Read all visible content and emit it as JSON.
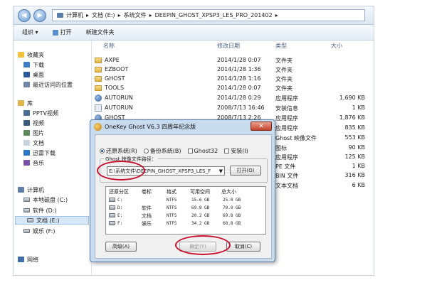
{
  "address_bar": {
    "crumbs": [
      "计算机",
      "▸",
      "文档 (E:)",
      "▸",
      "系统文件",
      "▸",
      "DEEPIN_GHOST_XPSP3_LES_PRO_201402",
      "▸"
    ],
    "back_glyph": "◀",
    "forward_glyph": "▶"
  },
  "toolbar": {
    "organize": "组织 ▾",
    "open": "打开",
    "new_folder": "新建文件夹"
  },
  "sidebar": {
    "favorites": "收藏夹",
    "fav_items": [
      "下载",
      "桌面",
      "最近访问的位置"
    ],
    "library": "库",
    "lib_items": [
      "PPTV视频",
      "视频",
      "图片",
      "文档",
      "迅雷下载",
      "音乐"
    ],
    "computer": "计算机",
    "drives": [
      "本地磁盘 (C:)",
      "软件 (D:)",
      "文档 (E:)",
      "娱乐 (F:)"
    ],
    "network": "网络"
  },
  "list": {
    "headers": {
      "name": "名称",
      "date": "修改日期",
      "type": "类型",
      "size": "大小"
    },
    "rows": [
      {
        "name": "AXPE",
        "date": "2014/1/28 0:07",
        "type": "文件夹",
        "size": "",
        "icon": "folder-icon"
      },
      {
        "name": "EZBOOT",
        "date": "2014/1/28 1:36",
        "type": "文件夹",
        "size": "",
        "icon": "folder-icon"
      },
      {
        "name": "GHOST",
        "date": "2014/1/28 1:16",
        "type": "文件夹",
        "size": "",
        "icon": "folder-icon"
      },
      {
        "name": "TOOLS",
        "date": "2014/1/28 0:07",
        "type": "文件夹",
        "size": "",
        "icon": "folder-icon"
      },
      {
        "name": "AUTORUN",
        "date": "2014/1/28 0:29",
        "type": "应用程序",
        "size": "1,690 KB",
        "icon": "app-icon"
      },
      {
        "name": "AUTORUN",
        "date": "2008/7/13 16:46",
        "type": "安装信息",
        "size": "1 KB",
        "icon": "info-icon"
      },
      {
        "name": "GHOST",
        "date": "2008/7/13 2:26",
        "type": "应用程序",
        "size": "1,876 KB",
        "icon": "app-icon"
      },
      {
        "name": "",
        "date": "",
        "type": "应用程序",
        "size": "835 KB",
        "icon": ""
      },
      {
        "name": "",
        "date": "",
        "type": "Ghost 映像文件",
        "size": "553 KB",
        "icon": ""
      },
      {
        "name": "",
        "date": "",
        "type": "图标",
        "size": "90 KB",
        "icon": ""
      },
      {
        "name": "",
        "date": "",
        "type": "应用程序",
        "size": "125 KB",
        "icon": ""
      },
      {
        "name": "",
        "date": "",
        "type": "PE 文件",
        "size": "1 KB",
        "icon": ""
      },
      {
        "name": "",
        "date": "",
        "type": "BIN 文件",
        "size": "316 KB",
        "icon": ""
      },
      {
        "name": "",
        "date": "",
        "type": "文本文档",
        "size": "6 KB",
        "icon": ""
      }
    ]
  },
  "dialog": {
    "title": "OneKey Ghost V6.3 四周年纪念版",
    "close_glyph": "✕",
    "options": {
      "restore": "还原系统(R)",
      "backup": "备份系统(B)",
      "ghost32": "Ghost32",
      "install": "安装(I)"
    },
    "group_label": "Ghost 映像文件路径：",
    "path_value": "E:\\系统文件\\DEEPIN_GHOST_XPSP3_LES_F",
    "open_button": "打开(O)",
    "table_headers": [
      "还原分区",
      "卷标",
      "格式",
      "可用空间",
      "总大小"
    ],
    "partitions": [
      {
        "drive": "C:",
        "label": "",
        "fs": "NTFS",
        "free": "15.6 GB",
        "total": "25.0 GB"
      },
      {
        "drive": "D:",
        "label": "软件",
        "fs": "NTFS",
        "free": "69.8 GB",
        "total": "70.0 GB"
      },
      {
        "drive": "E:",
        "label": "文档",
        "fs": "NTFS",
        "free": "20.2 GB",
        "total": "69.8 GB"
      },
      {
        "drive": "F:",
        "label": "娱乐",
        "fs": "NTFS",
        "free": "34.2 GB",
        "total": "68.8 GB"
      }
    ],
    "advanced_button": "高级(A)",
    "ok_button": "确定(Y)",
    "cancel_button": "取消(C)"
  }
}
